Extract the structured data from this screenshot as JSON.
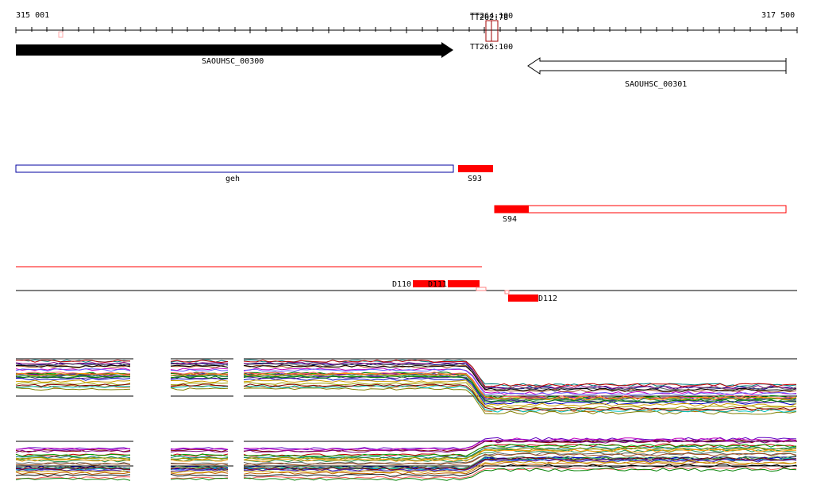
{
  "ruler": {
    "start_label": "315 001",
    "end_label": "317 500"
  },
  "terminators": {
    "top_overlap_a": "TT264:100",
    "top_overlap_b": "TT262:78",
    "bottom": "TT265:100"
  },
  "genes": [
    {
      "id": "gene-forward",
      "label": "SAOUHSC_00300",
      "strand": "+",
      "fill": "#000000"
    },
    {
      "id": "gene-reverse",
      "label": "SAOUHSC_00301",
      "strand": "-",
      "fill": "#ffffff"
    }
  ],
  "annotations": {
    "geh": "geh",
    "S93": "S93",
    "S94": "S94"
  },
  "segments": {
    "D110": "D110",
    "D111": "D111",
    "D112": "D112"
  },
  "colors": {
    "accent_red": "#ff0000",
    "outline_blue": "#0000a0",
    "axis": "#000000"
  }
}
